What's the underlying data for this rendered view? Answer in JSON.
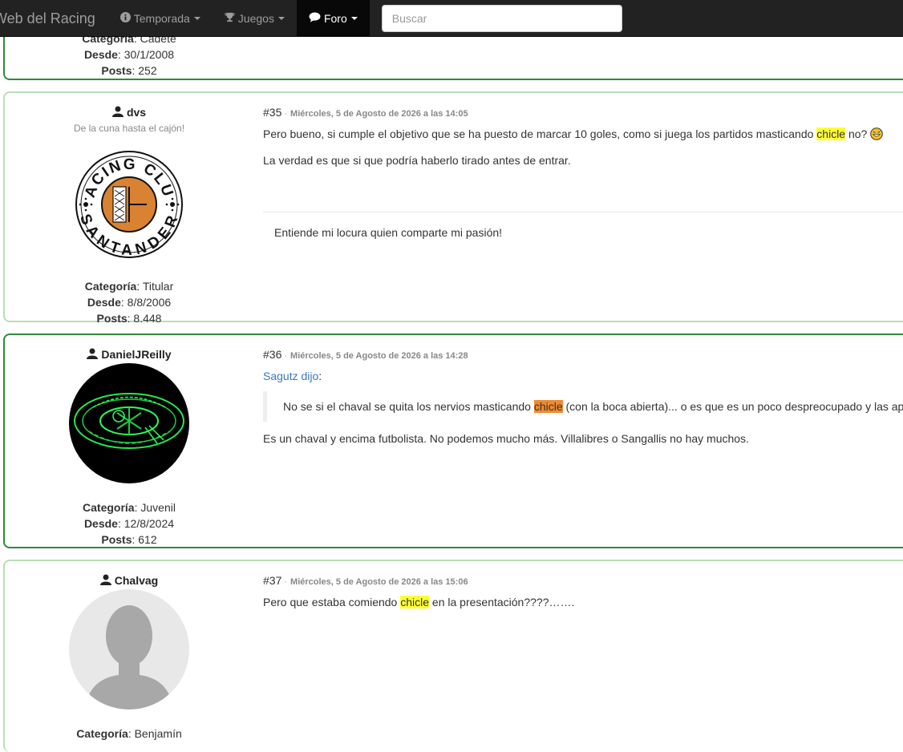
{
  "nav": {
    "brand": "Web del Racing",
    "items": [
      {
        "label": "Temporada",
        "icon": "info-icon"
      },
      {
        "label": "Juegos",
        "icon": "trophy-icon"
      },
      {
        "label": "Foro",
        "icon": "comments-icon"
      }
    ],
    "search_placeholder": "Buscar"
  },
  "labels": {
    "category": "Categoría",
    "since": "Desde",
    "posts": "Posts"
  },
  "prev_post": {
    "category": "Cadete",
    "since": "30/1/2008",
    "posts": "252"
  },
  "posts": [
    {
      "number": "#35",
      "date": "Miércoles, 5 de Agosto de 2026 a las 14:05",
      "user": "dvs",
      "motto": "De la cuna hasta el cajón!",
      "category": "Titular",
      "since": "8/8/2006",
      "posts": "8.448",
      "avatar_text_top": "RACING CLUB",
      "avatar_text_bottom": "SANTANDER",
      "p1_before": "Pero bueno, si cumple el objetivo que se ha puesto de marcar 10 goles, como si juega los partidos masticando ",
      "p1_hl": "chicle",
      "p1_after": " no? ",
      "p2": "La verdad es que si que podría haberlo tirado antes de entrar.",
      "signature": "Entiende mi locura quien comparte mi pasión!"
    },
    {
      "number": "#36",
      "date": "Miércoles, 5 de Agosto de 2026 a las 14:28",
      "user": "DanielJReilly",
      "category": "Juvenil",
      "since": "12/8/2024",
      "posts": "612",
      "quote_author": "Sagutz dijo",
      "quote_colon": ":",
      "quote_before": "No se si el chaval se quita los nervios masticando ",
      "quote_hl": "chicle",
      "quote_after": " (con la boca abierta)... o es que es un poco despreocupado y las ap",
      "body": "Es un chaval y encima futbolista. No podemos mucho más. Villalibres o Sangallis no hay muchos."
    },
    {
      "number": "#37",
      "date": "Miércoles, 5 de Agosto de 2026 a las 15:06",
      "user": "Chalvag",
      "category": "Benjamín",
      "p1_before": "Pero que estaba comiendo ",
      "p1_hl": "chicle",
      "p1_after": " en la presentación????……."
    }
  ],
  "colors": {
    "navbar": "#222222",
    "card_border_light": "#b8deb8",
    "card_border_dark": "#2e8b3a",
    "highlight": "#ffff33",
    "highlight_alt": "#f08a30",
    "link": "#3a7ab8"
  }
}
